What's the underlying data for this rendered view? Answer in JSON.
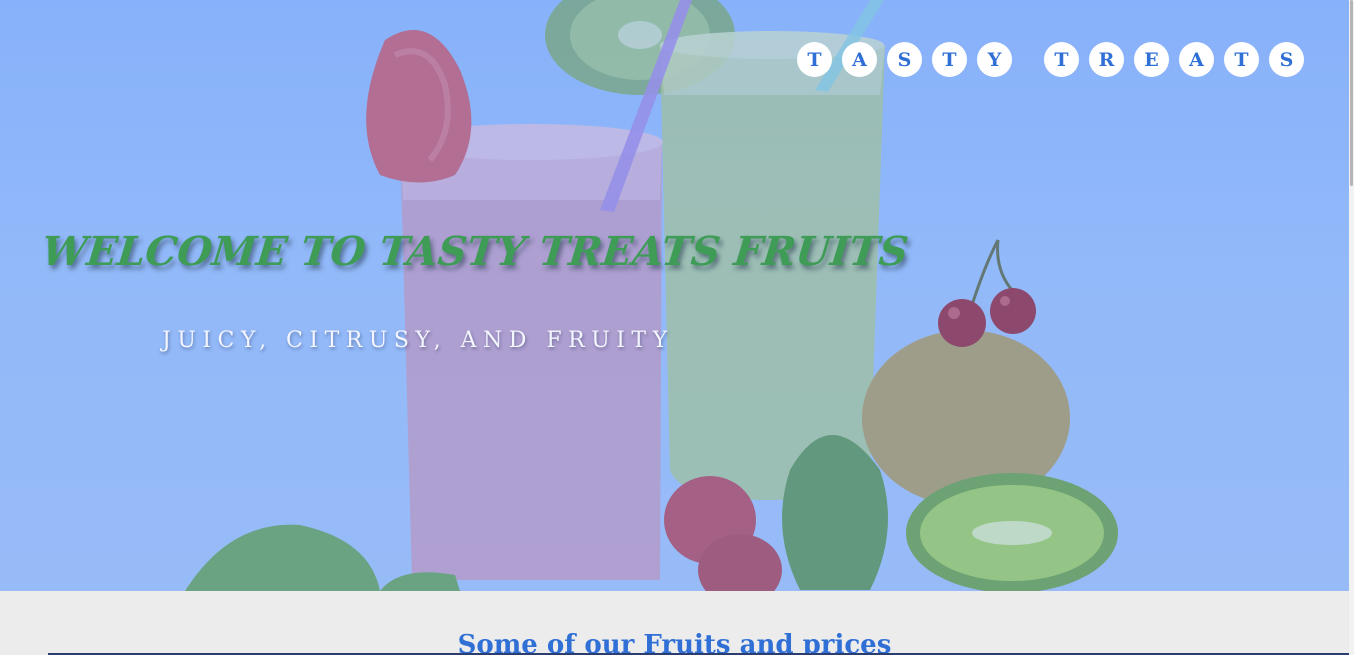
{
  "hero": {
    "headline": "WELCOME TO TASTY TREATS FRUITS",
    "tagline": "JUICY, CITRUSY, AND FRUITY"
  },
  "logo": {
    "word1": [
      "T",
      "A",
      "S",
      "T",
      "Y"
    ],
    "word2": [
      "T",
      "R",
      "E",
      "A",
      "T",
      "S"
    ]
  },
  "section": {
    "title": "Some of our Fruits and prices"
  },
  "colors": {
    "overlay_blue": "#86b1fb",
    "headline_green": "#3e9c57",
    "accent_blue": "#2f6fd6"
  }
}
